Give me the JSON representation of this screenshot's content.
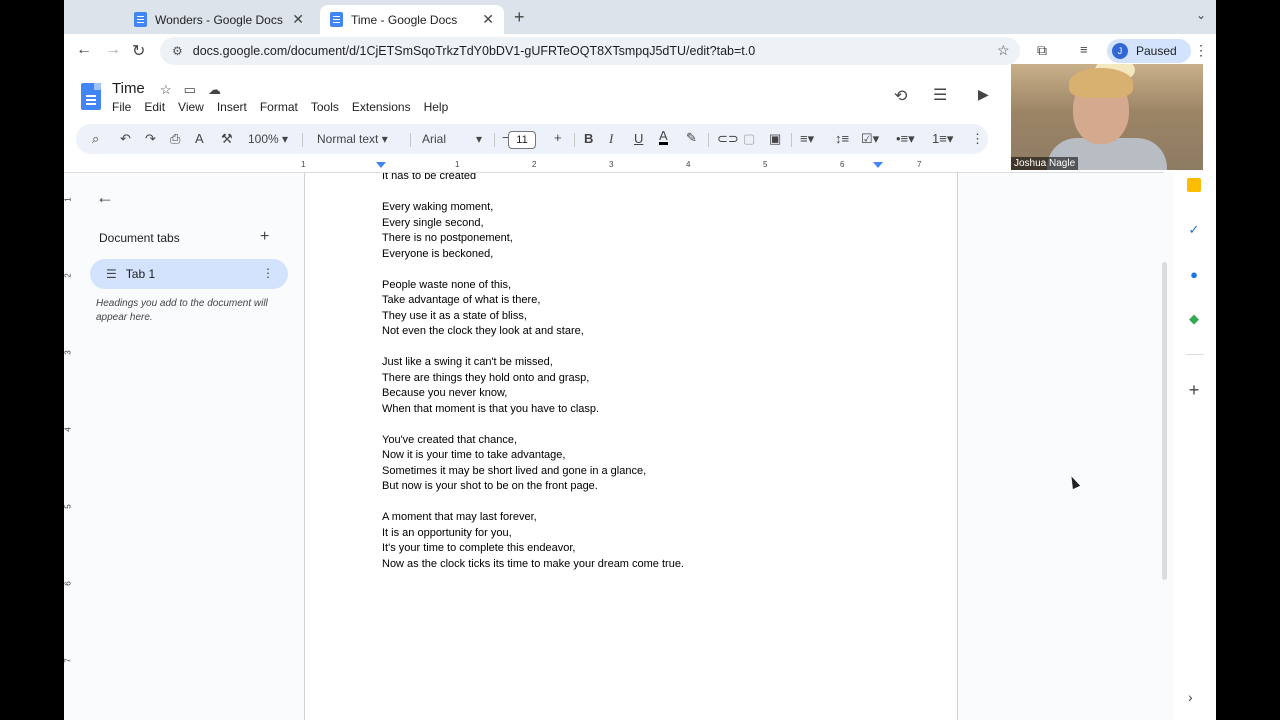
{
  "browser": {
    "tabs": [
      {
        "title": "Wonders - Google Docs",
        "active": false
      },
      {
        "title": "Time - Google Docs",
        "active": true
      }
    ],
    "url": "docs.google.com/document/d/1CjETSmSqoTrkzTdY0bDV1-gUFRTeOQT8XTsmpqJ5dTU/edit?tab=t.0",
    "profile_initial": "J",
    "profile_status": "Paused"
  },
  "docs": {
    "title": "Time",
    "menu": [
      "File",
      "Edit",
      "View",
      "Insert",
      "Format",
      "Tools",
      "Extensions",
      "Help"
    ]
  },
  "toolbar": {
    "zoom": "100%",
    "style": "Normal text",
    "font": "Arial",
    "font_size": "11"
  },
  "ruler_ticks": [
    "1",
    "1",
    "2",
    "3",
    "4",
    "5",
    "6",
    "7"
  ],
  "vertical_ruler_ticks": [
    "1",
    "2",
    "3",
    "4",
    "5",
    "6",
    "7"
  ],
  "sidebar": {
    "heading": "Document tabs",
    "tab_label": "Tab 1",
    "hint": "Headings you add to the document will appear here."
  },
  "document": {
    "stanzas": [
      [
        "It has to be created"
      ],
      [
        "Every waking moment,",
        "Every single second,",
        "There is no postponement,",
        "Everyone is beckoned,"
      ],
      [
        "People waste none of this,",
        "Take advantage of what is there,",
        "They use it as a state of bliss,",
        "Not even the clock they look at and stare,"
      ],
      [
        "Just like a swing it can't be missed,",
        "There are things they hold onto and grasp,",
        "Because you never know,",
        "When that moment is that you have to clasp."
      ],
      [
        "You've created that chance,",
        "Now it is your time to take advantage,",
        "Sometimes it may be short lived and gone in a glance,",
        "But now is your shot to be on the front page."
      ],
      [
        "A moment that may last forever,",
        "It is an opportunity for you,",
        "It's your time to complete this endeavor,",
        "Now as the clock ticks its time to make your dream come true."
      ]
    ]
  },
  "video": {
    "participant_name": "Joshua Nagle"
  },
  "colors": {
    "accent": "#4285f4",
    "selected_tab": "#d3e3fd",
    "toolbar_bg": "#edf2fa"
  }
}
